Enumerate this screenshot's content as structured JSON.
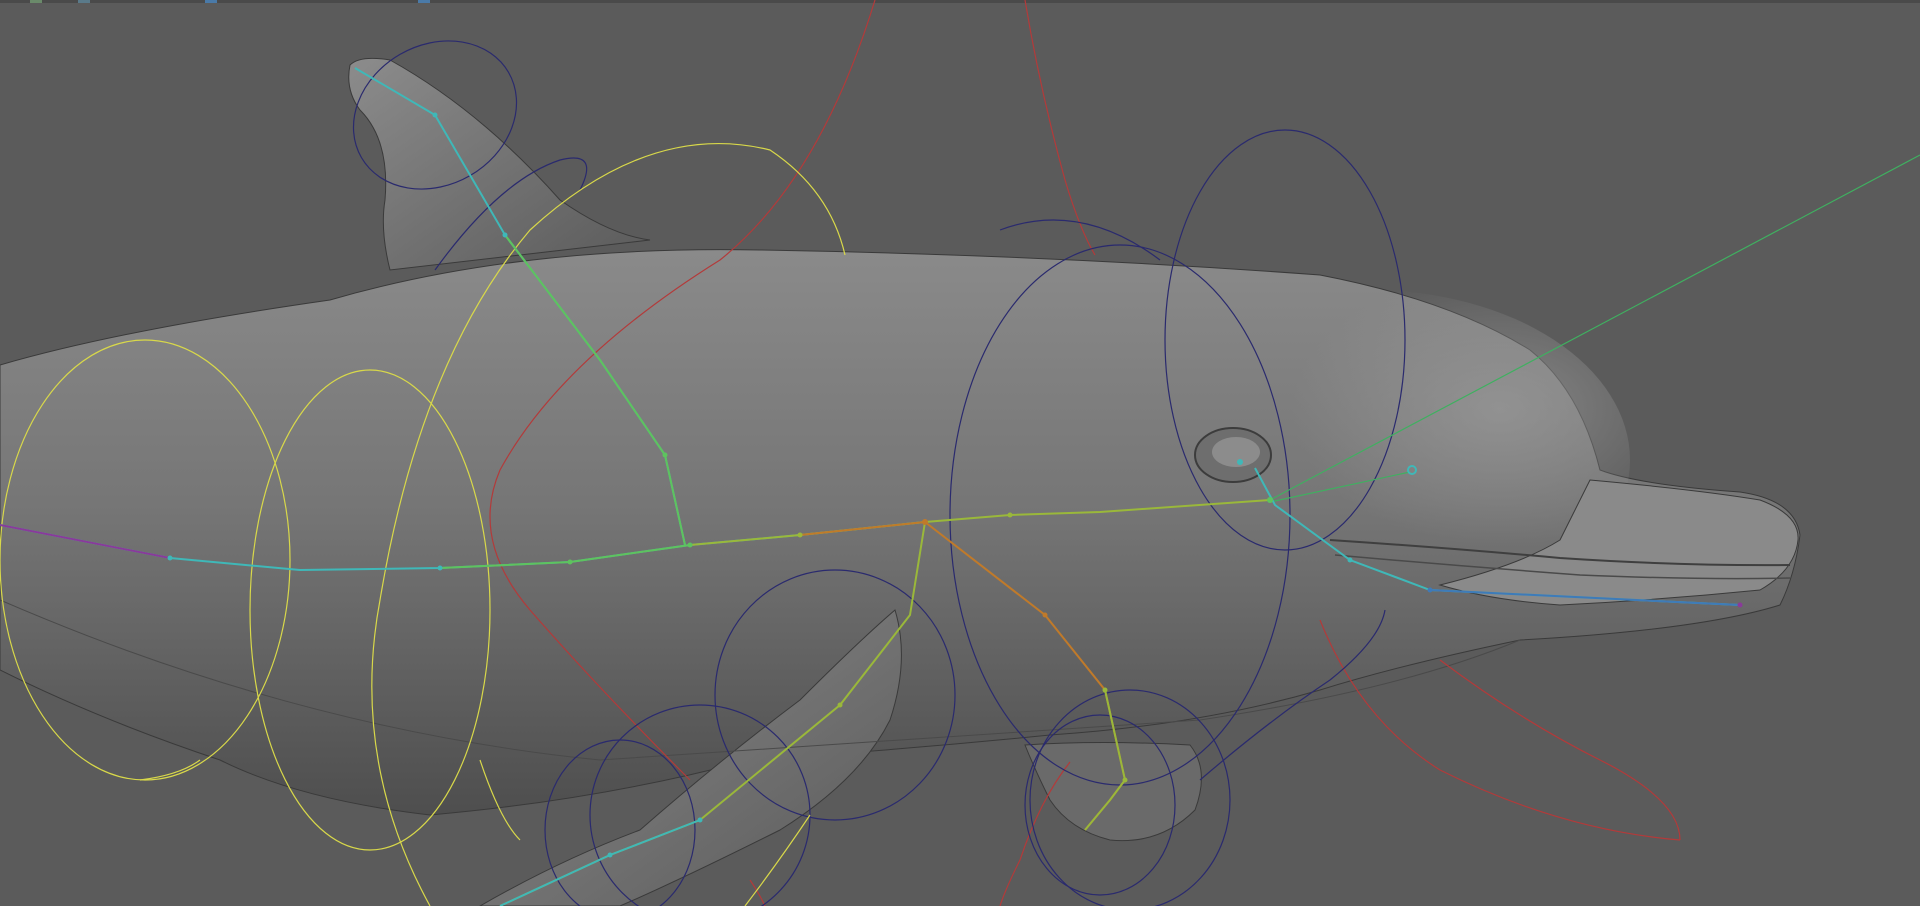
{
  "viewport": {
    "background": "#5b5b5b",
    "subject": "dolphin-mesh",
    "mesh_color": "#7a7a7a"
  },
  "colors": {
    "spine_controls": "#d8d84a",
    "ik_controls": "#2a2a6e",
    "red_curves": "#b33a3a",
    "green_line": "#3fb060",
    "joints_cyan": "#3fb8b8",
    "joints_orange": "#c07a2a",
    "joints_purple": "#8a3a9a"
  },
  "toolbar": {
    "icons": [
      "toolbar-icon-1",
      "toolbar-icon-2",
      "toolbar-icon-3",
      "toolbar-icon-4"
    ]
  }
}
